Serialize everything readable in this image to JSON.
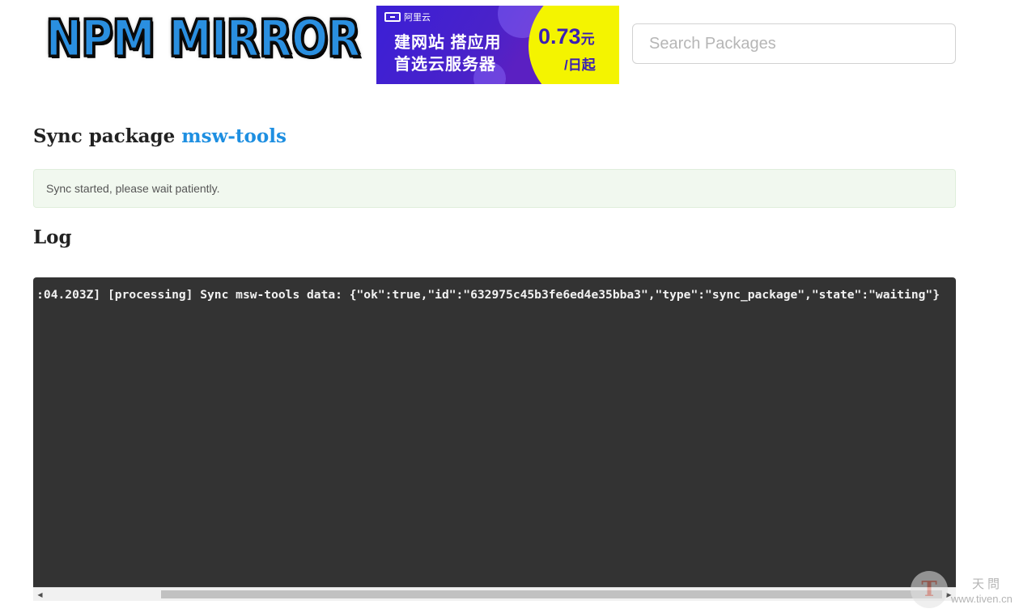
{
  "header": {
    "logo_text": "NPM MIRROR",
    "search_placeholder": "Search Packages"
  },
  "ad": {
    "brand": "阿里云",
    "line1": "建网站 搭应用",
    "line2": "首选云服务器",
    "price": "0.73",
    "price_unit": "元",
    "per": "/日起"
  },
  "sync": {
    "title_prefix": "Sync package",
    "package_name": "msw-tools",
    "notice": "Sync started, please wait patiently."
  },
  "log": {
    "heading": "Log",
    "lines": [
      ":04.203Z] [processing] Sync msw-tools data: {\"ok\":true,\"id\":\"632975c45b3fe6ed4e35bba3\",\"type\":\"sync_package\",\"state\":\"waiting\"}"
    ]
  },
  "watermark": {
    "logo": "T",
    "name": "天問",
    "url": "www.tiven.cn"
  },
  "colors": {
    "link": "#1e8fe1",
    "notice_bg": "#f1f8ef",
    "log_bg": "#333333",
    "ad_purple": "#4a22c9",
    "ad_yellow": "#f4f400"
  }
}
